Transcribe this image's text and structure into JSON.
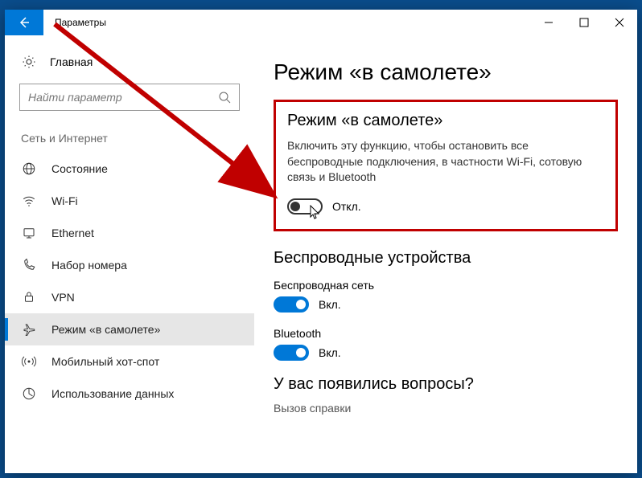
{
  "titlebar": {
    "title": "Параметры"
  },
  "sidebar": {
    "home": "Главная",
    "search_placeholder": "Найти параметр",
    "section": "Сеть и Интернет",
    "items": [
      {
        "label": "Состояние"
      },
      {
        "label": "Wi-Fi"
      },
      {
        "label": "Ethernet"
      },
      {
        "label": "Набор номера"
      },
      {
        "label": "VPN"
      },
      {
        "label": "Режим «в самолете»"
      },
      {
        "label": "Мобильный хот-спот"
      },
      {
        "label": "Использование данных"
      }
    ]
  },
  "content": {
    "page_title": "Режим «в самолете»",
    "airplane": {
      "heading": "Режим «в самолете»",
      "description": "Включить эту функцию, чтобы остановить все беспроводные подключения, в частности Wi-Fi, сотовую связь и Bluetooth",
      "state_label": "Откл."
    },
    "wireless": {
      "heading": "Беспроводные устройства",
      "wifi_label": "Беспроводная сеть",
      "wifi_state": "Вкл.",
      "bt_label": "Bluetooth",
      "bt_state": "Вкл."
    },
    "help": {
      "heading": "У вас появились вопросы?",
      "link": "Вызов справки"
    }
  }
}
